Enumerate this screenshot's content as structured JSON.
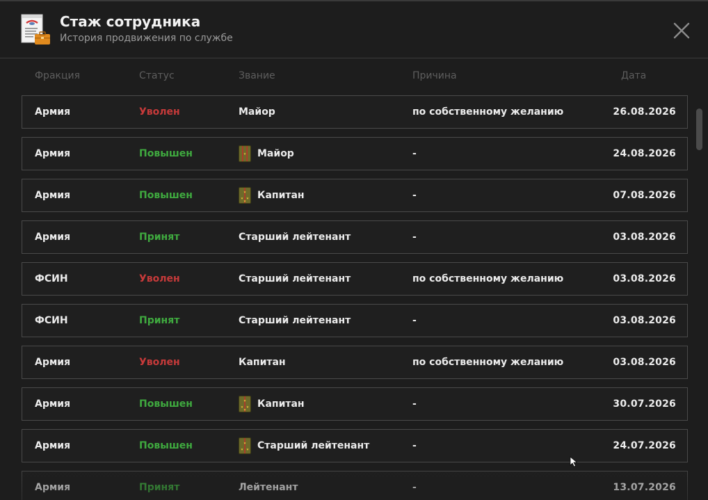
{
  "header": {
    "title": "Стаж сотрудника",
    "subtitle": "История продвижения по службе",
    "app_icon": "document-briefcase-icon",
    "close_icon": "close-icon"
  },
  "columns": {
    "faction": "Фракция",
    "status": "Статус",
    "rank": "Звание",
    "reason": "Причина",
    "date": "Дата"
  },
  "colors": {
    "fired": "#c73a3a",
    "promoted": "#3faa3f",
    "background": "#1d1d1d",
    "row_border": "#4a4a4a"
  },
  "rows": [
    {
      "faction": "Армия",
      "status": "Уволен",
      "status_type": "fired",
      "rank": "Майор",
      "rank_icon": "",
      "reason": "по собственному желанию",
      "date": "26.08.2026"
    },
    {
      "faction": "Армия",
      "status": "Повышен",
      "status_type": "promoted",
      "rank": "Майор",
      "rank_icon": "major-shoulder-strap-icon",
      "reason": "-",
      "date": "24.08.2026"
    },
    {
      "faction": "Армия",
      "status": "Повышен",
      "status_type": "promoted",
      "rank": "Капитан",
      "rank_icon": "captain-shoulder-strap-icon",
      "reason": "-",
      "date": "07.08.2026"
    },
    {
      "faction": "Армия",
      "status": "Принят",
      "status_type": "hired",
      "rank": "Старший лейтенант",
      "rank_icon": "",
      "reason": "-",
      "date": "03.08.2026"
    },
    {
      "faction": "ФСИН",
      "status": "Уволен",
      "status_type": "fired",
      "rank": "Старший лейтенант",
      "rank_icon": "",
      "reason": "по собственному желанию",
      "date": "03.08.2026"
    },
    {
      "faction": "ФСИН",
      "status": "Принят",
      "status_type": "hired",
      "rank": "Старший лейтенант",
      "rank_icon": "",
      "reason": "-",
      "date": "03.08.2026"
    },
    {
      "faction": "Армия",
      "status": "Уволен",
      "status_type": "fired",
      "rank": "Капитан",
      "rank_icon": "",
      "reason": "по собственному желанию",
      "date": "03.08.2026"
    },
    {
      "faction": "Армия",
      "status": "Повышен",
      "status_type": "promoted",
      "rank": "Капитан",
      "rank_icon": "captain-shoulder-strap-icon",
      "reason": "-",
      "date": "30.07.2026"
    },
    {
      "faction": "Армия",
      "status": "Повышен",
      "status_type": "promoted",
      "rank": "Старший лейтенант",
      "rank_icon": "senior-lieutenant-shoulder-strap-icon",
      "reason": "-",
      "date": "24.07.2026"
    },
    {
      "faction": "Армия",
      "status": "Принят",
      "status_type": "hired",
      "rank": "Лейтенант",
      "rank_icon": "",
      "reason": "-",
      "date": "13.07.2026"
    }
  ]
}
